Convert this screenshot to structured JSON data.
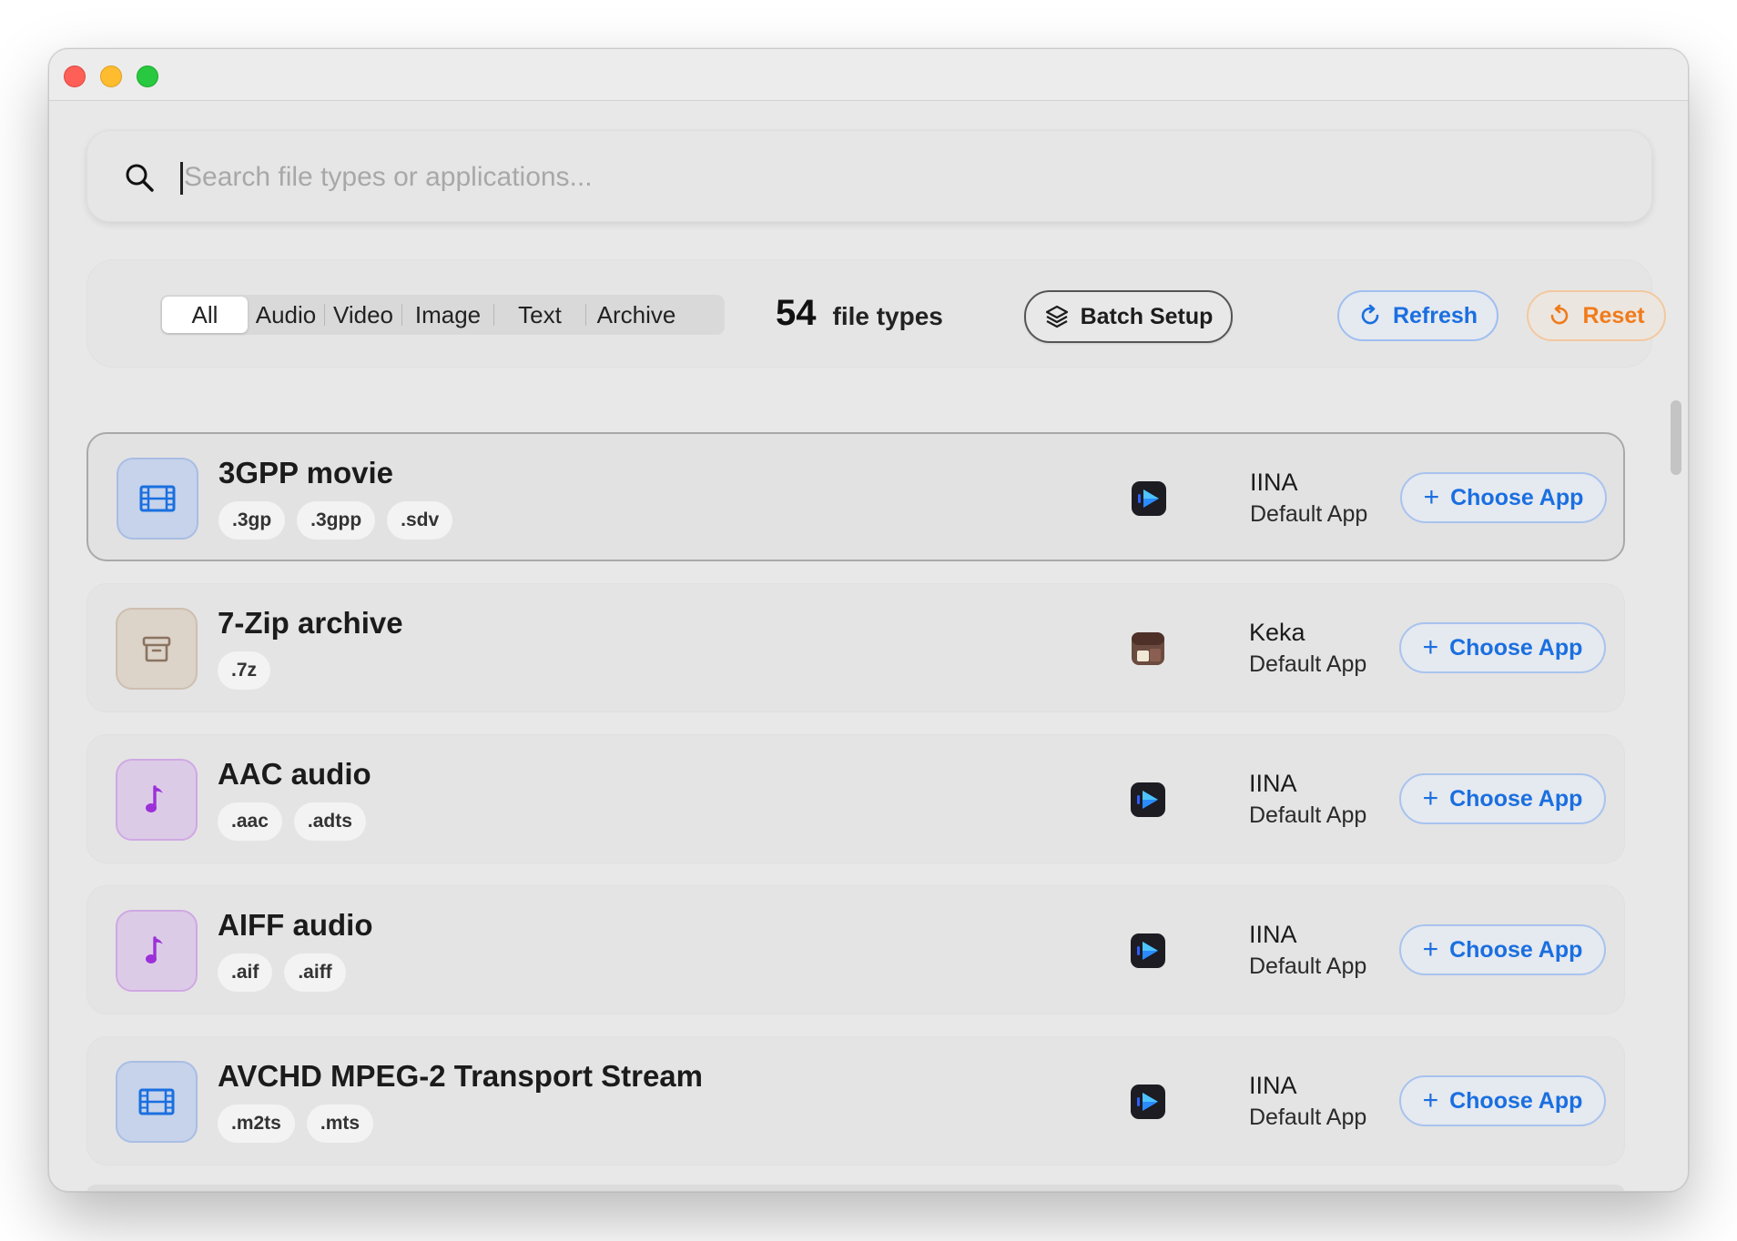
{
  "window": {
    "traffic_lights": [
      "close",
      "minimize",
      "zoom"
    ]
  },
  "search": {
    "placeholder": "Search file types or applications...",
    "value": ""
  },
  "filters": {
    "tabs": [
      "All",
      "Audio",
      "Video",
      "Image",
      "Text",
      "Archive"
    ],
    "selected": "All"
  },
  "summary": {
    "count": "54",
    "label": "file types"
  },
  "actions": {
    "batch_label": "Batch Setup",
    "refresh_label": "Refresh",
    "reset_label": "Reset"
  },
  "colors": {
    "accent_blue": "#1a6fe0",
    "reset_orange": "#f07b1a",
    "video_icon": "#1a6fe0",
    "audio_icon": "#9b30d9",
    "archive_icon": "#8a7360"
  },
  "rows": [
    {
      "title": "3GPP movie",
      "kind": "video",
      "exts": [
        ".3gp",
        ".3gpp",
        ".sdv"
      ],
      "app": "IINA",
      "app_icon": "iina-icon",
      "app_sub": "Default App",
      "choose_label": "Choose App",
      "selected": true
    },
    {
      "title": "7-Zip archive",
      "kind": "archive",
      "exts": [
        ".7z"
      ],
      "app": "Keka",
      "app_icon": "keka-icon",
      "app_sub": "Default App",
      "choose_label": "Choose App",
      "selected": false
    },
    {
      "title": "AAC audio",
      "kind": "audio",
      "exts": [
        ".aac",
        ".adts"
      ],
      "app": "IINA",
      "app_icon": "iina-icon",
      "app_sub": "Default App",
      "choose_label": "Choose App",
      "selected": false
    },
    {
      "title": "AIFF audio",
      "kind": "audio",
      "exts": [
        ".aif",
        ".aiff"
      ],
      "app": "IINA",
      "app_icon": "iina-icon",
      "app_sub": "Default App",
      "choose_label": "Choose App",
      "selected": false
    },
    {
      "title": "AVCHD MPEG-2 Transport Stream",
      "kind": "video",
      "exts": [
        ".m2ts",
        ".mts"
      ],
      "app": "IINA",
      "app_icon": "iina-icon",
      "app_sub": "Default App",
      "choose_label": "Choose App",
      "selected": false
    }
  ]
}
